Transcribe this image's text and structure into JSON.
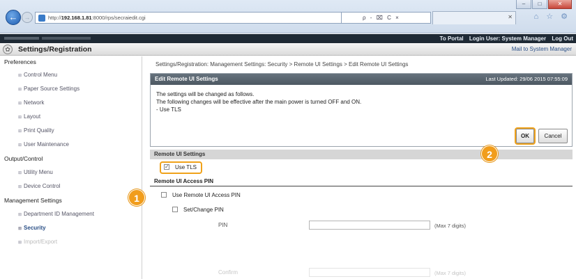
{
  "browser": {
    "url_prefix": "http://",
    "url_host": "192.168.1.81",
    "url_rest": ":8000/rps/secraiedit.cgi",
    "search_controls": "ρ - ⌧ C ×",
    "tools": "⌂ ☆ ⚙",
    "window_controls": [
      "–",
      "□",
      "✕"
    ]
  },
  "topbar": {
    "to_portal": "To Portal",
    "login_user": "Login User: System Manager",
    "logout": "Log Out"
  },
  "header": {
    "title": "Settings/Registration",
    "mail_link": "Mail to System Manager"
  },
  "sidebar": {
    "preferences": "Preferences",
    "pref_items": [
      "Control Menu",
      "Paper Source Settings",
      "Network",
      "Layout",
      "Print Quality",
      "User Maintenance"
    ],
    "output": "Output/Control",
    "output_items": [
      "Utility Menu",
      "Device Control"
    ],
    "management": "Management Settings",
    "mgmt_items": [
      "Department ID Management",
      "Security",
      "Import/Export"
    ]
  },
  "main": {
    "breadcrumb": "Settings/Registration: Management Settings: Security > Remote UI Settings > Edit Remote UI Settings",
    "edit_title": "Edit Remote UI Settings",
    "last_updated": "Last Updated: 29/06 2015 07:55:09",
    "message_lines": [
      "The settings will be changed as follows.",
      "The following changes will be effective after the main power is turned OFF and ON.",
      "- Use TLS"
    ],
    "ok_label": "OK",
    "cancel_label": "Cancel",
    "remote_ui_settings_head": "Remote UI Settings",
    "use_tls_label": "Use TLS",
    "use_tls_checked": true,
    "access_pin_head": "Remote UI Access PIN",
    "use_access_pin_label": "Use Remote UI Access PIN",
    "set_change_pin_label": "Set/Change PIN",
    "pin_label": "PIN",
    "pin_hint": "(Max 7 digits)",
    "confirm_label": "Confirm",
    "confirm_hint": "(Max 7 digits)"
  },
  "callouts": [
    "1",
    "2"
  ],
  "colors": {
    "callout": "#f19d1c",
    "header_bar": "#4d5862",
    "topbar": "#1f2a35"
  }
}
